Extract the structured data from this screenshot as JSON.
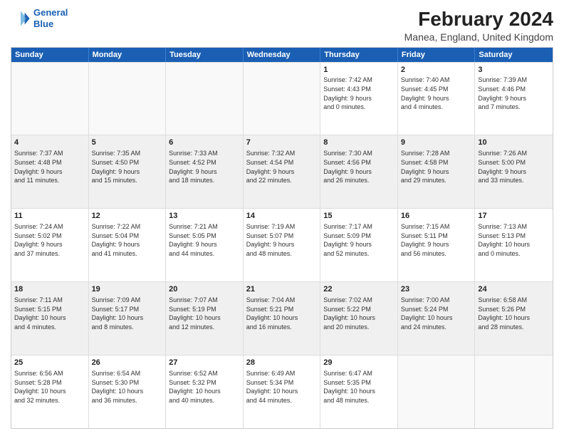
{
  "logo": {
    "line1": "General",
    "line2": "Blue"
  },
  "title": "February 2024",
  "subtitle": "Manea, England, United Kingdom",
  "days": [
    "Sunday",
    "Monday",
    "Tuesday",
    "Wednesday",
    "Thursday",
    "Friday",
    "Saturday"
  ],
  "rows": [
    [
      {
        "day": "",
        "text": "",
        "empty": true
      },
      {
        "day": "",
        "text": "",
        "empty": true
      },
      {
        "day": "",
        "text": "",
        "empty": true
      },
      {
        "day": "",
        "text": "",
        "empty": true
      },
      {
        "day": "1",
        "text": "Sunrise: 7:42 AM\nSunset: 4:43 PM\nDaylight: 9 hours\nand 0 minutes."
      },
      {
        "day": "2",
        "text": "Sunrise: 7:40 AM\nSunset: 4:45 PM\nDaylight: 9 hours\nand 4 minutes."
      },
      {
        "day": "3",
        "text": "Sunrise: 7:39 AM\nSunset: 4:46 PM\nDaylight: 9 hours\nand 7 minutes."
      }
    ],
    [
      {
        "day": "4",
        "text": "Sunrise: 7:37 AM\nSunset: 4:48 PM\nDaylight: 9 hours\nand 11 minutes."
      },
      {
        "day": "5",
        "text": "Sunrise: 7:35 AM\nSunset: 4:50 PM\nDaylight: 9 hours\nand 15 minutes."
      },
      {
        "day": "6",
        "text": "Sunrise: 7:33 AM\nSunset: 4:52 PM\nDaylight: 9 hours\nand 18 minutes."
      },
      {
        "day": "7",
        "text": "Sunrise: 7:32 AM\nSunset: 4:54 PM\nDaylight: 9 hours\nand 22 minutes."
      },
      {
        "day": "8",
        "text": "Sunrise: 7:30 AM\nSunset: 4:56 PM\nDaylight: 9 hours\nand 26 minutes."
      },
      {
        "day": "9",
        "text": "Sunrise: 7:28 AM\nSunset: 4:58 PM\nDaylight: 9 hours\nand 29 minutes."
      },
      {
        "day": "10",
        "text": "Sunrise: 7:26 AM\nSunset: 5:00 PM\nDaylight: 9 hours\nand 33 minutes."
      }
    ],
    [
      {
        "day": "11",
        "text": "Sunrise: 7:24 AM\nSunset: 5:02 PM\nDaylight: 9 hours\nand 37 minutes."
      },
      {
        "day": "12",
        "text": "Sunrise: 7:22 AM\nSunset: 5:04 PM\nDaylight: 9 hours\nand 41 minutes."
      },
      {
        "day": "13",
        "text": "Sunrise: 7:21 AM\nSunset: 5:05 PM\nDaylight: 9 hours\nand 44 minutes."
      },
      {
        "day": "14",
        "text": "Sunrise: 7:19 AM\nSunset: 5:07 PM\nDaylight: 9 hours\nand 48 minutes."
      },
      {
        "day": "15",
        "text": "Sunrise: 7:17 AM\nSunset: 5:09 PM\nDaylight: 9 hours\nand 52 minutes."
      },
      {
        "day": "16",
        "text": "Sunrise: 7:15 AM\nSunset: 5:11 PM\nDaylight: 9 hours\nand 56 minutes."
      },
      {
        "day": "17",
        "text": "Sunrise: 7:13 AM\nSunset: 5:13 PM\nDaylight: 10 hours\nand 0 minutes."
      }
    ],
    [
      {
        "day": "18",
        "text": "Sunrise: 7:11 AM\nSunset: 5:15 PM\nDaylight: 10 hours\nand 4 minutes."
      },
      {
        "day": "19",
        "text": "Sunrise: 7:09 AM\nSunset: 5:17 PM\nDaylight: 10 hours\nand 8 minutes."
      },
      {
        "day": "20",
        "text": "Sunrise: 7:07 AM\nSunset: 5:19 PM\nDaylight: 10 hours\nand 12 minutes."
      },
      {
        "day": "21",
        "text": "Sunrise: 7:04 AM\nSunset: 5:21 PM\nDaylight: 10 hours\nand 16 minutes."
      },
      {
        "day": "22",
        "text": "Sunrise: 7:02 AM\nSunset: 5:22 PM\nDaylight: 10 hours\nand 20 minutes."
      },
      {
        "day": "23",
        "text": "Sunrise: 7:00 AM\nSunset: 5:24 PM\nDaylight: 10 hours\nand 24 minutes."
      },
      {
        "day": "24",
        "text": "Sunrise: 6:58 AM\nSunset: 5:26 PM\nDaylight: 10 hours\nand 28 minutes."
      }
    ],
    [
      {
        "day": "25",
        "text": "Sunrise: 6:56 AM\nSunset: 5:28 PM\nDaylight: 10 hours\nand 32 minutes."
      },
      {
        "day": "26",
        "text": "Sunrise: 6:54 AM\nSunset: 5:30 PM\nDaylight: 10 hours\nand 36 minutes."
      },
      {
        "day": "27",
        "text": "Sunrise: 6:52 AM\nSunset: 5:32 PM\nDaylight: 10 hours\nand 40 minutes."
      },
      {
        "day": "28",
        "text": "Sunrise: 6:49 AM\nSunset: 5:34 PM\nDaylight: 10 hours\nand 44 minutes."
      },
      {
        "day": "29",
        "text": "Sunrise: 6:47 AM\nSunset: 5:35 PM\nDaylight: 10 hours\nand 48 minutes."
      },
      {
        "day": "",
        "text": "",
        "empty": true
      },
      {
        "day": "",
        "text": "",
        "empty": true
      }
    ]
  ]
}
